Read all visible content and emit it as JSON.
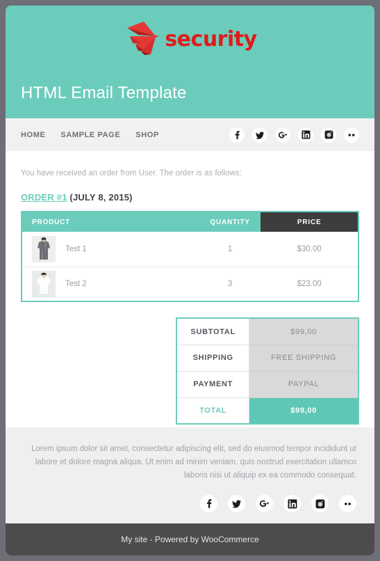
{
  "theme": {
    "accent": "#6bccbc",
    "accent_dark": "#5fc7b6",
    "dark": "#3d3d3d",
    "page_bg": "#6e6e76",
    "nav_bg": "#f1f1f1",
    "footer_bg": "#efefef",
    "bottombar_bg": "#4c4c4c",
    "logo_red": "#e01b1b"
  },
  "header": {
    "logo_text": "security",
    "logo_icon": "red-fan-arrow-logo-icon",
    "title": "HTML Email Template"
  },
  "nav": {
    "links": [
      {
        "label": "HOME"
      },
      {
        "label": "SAMPLE PAGE"
      },
      {
        "label": "SHOP"
      }
    ],
    "social": [
      {
        "name": "facebook-icon",
        "label": "Facebook"
      },
      {
        "name": "twitter-icon",
        "label": "Twitter"
      },
      {
        "name": "google-plus-icon",
        "label": "Google Plus"
      },
      {
        "name": "linkedin-icon",
        "label": "LinkedIn"
      },
      {
        "name": "instagram-icon",
        "label": "Instagram"
      },
      {
        "name": "more-dots-icon",
        "label": "More"
      }
    ]
  },
  "body": {
    "intro": "You have received an order from User. The order is as follows:",
    "order_link": "ORDER #1",
    "order_date": " (JULY 8, 2015)"
  },
  "products": {
    "columns": {
      "product": "PRODUCT",
      "quantity": "QUANTITY",
      "price": "PRICE"
    },
    "rows": [
      {
        "thumb": "gray-cardigan-thumbnail",
        "name": "Test 1",
        "quantity": "1",
        "price": "$30.00"
      },
      {
        "thumb": "white-tshirt-thumbnail",
        "name": "Test 2",
        "quantity": "3",
        "price": "$23.00"
      }
    ]
  },
  "totals": {
    "rows": [
      {
        "label": "SUBTOTAL",
        "value": "$99,00"
      },
      {
        "label": "SHIPPING",
        "value": "FREE SHIPPING"
      },
      {
        "label": "PAYMENT",
        "value": "PAYPAL"
      }
    ],
    "total": {
      "label": "TOTAL",
      "value": "$99,00"
    }
  },
  "footer": {
    "text": "Lorem ipsum dolor sit amet, consectetur adipiscing elit, sed do eiusmod tempor incididunt ut labore et dolore magna aliqua. Ut enim ad minim veniam, quis nostrud exercitation ullamco laboris nisi ut aliquip ex ea commodo consequat.",
    "social": [
      {
        "name": "facebook-icon",
        "label": "Facebook"
      },
      {
        "name": "twitter-icon",
        "label": "Twitter"
      },
      {
        "name": "google-plus-icon",
        "label": "Google Plus"
      },
      {
        "name": "linkedin-icon",
        "label": "LinkedIn"
      },
      {
        "name": "instagram-icon",
        "label": "Instagram"
      },
      {
        "name": "more-dots-icon",
        "label": "More"
      }
    ]
  },
  "bottombar": {
    "text": "My site - Powered by WooCommerce"
  }
}
